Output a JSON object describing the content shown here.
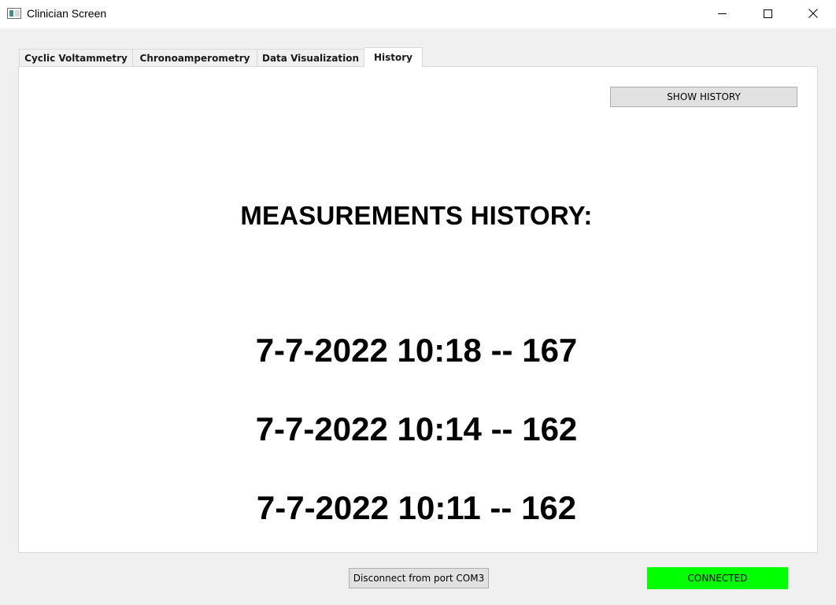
{
  "window": {
    "title": "Clinician Screen",
    "icons": [
      "app-icon",
      "minimize-icon",
      "maximize-icon",
      "close-icon"
    ]
  },
  "tabs": [
    {
      "label": "Cyclic Voltammetry",
      "active": false
    },
    {
      "label": "Chronoamperometry",
      "active": false
    },
    {
      "label": "Data Visualization",
      "active": false
    },
    {
      "label": "History",
      "active": true
    }
  ],
  "history": {
    "show_button_label": "SHOW HISTORY",
    "heading": "MEASUREMENTS HISTORY:",
    "entries": [
      "7-7-2022 10:18 -- 167",
      "7-7-2022 10:14 -- 162",
      "7-7-2022 10:11 -- 162"
    ]
  },
  "footer": {
    "disconnect_label": "Disconnect from port COM3",
    "status_label": "CONNECTED",
    "status_color": "#00ff00"
  }
}
